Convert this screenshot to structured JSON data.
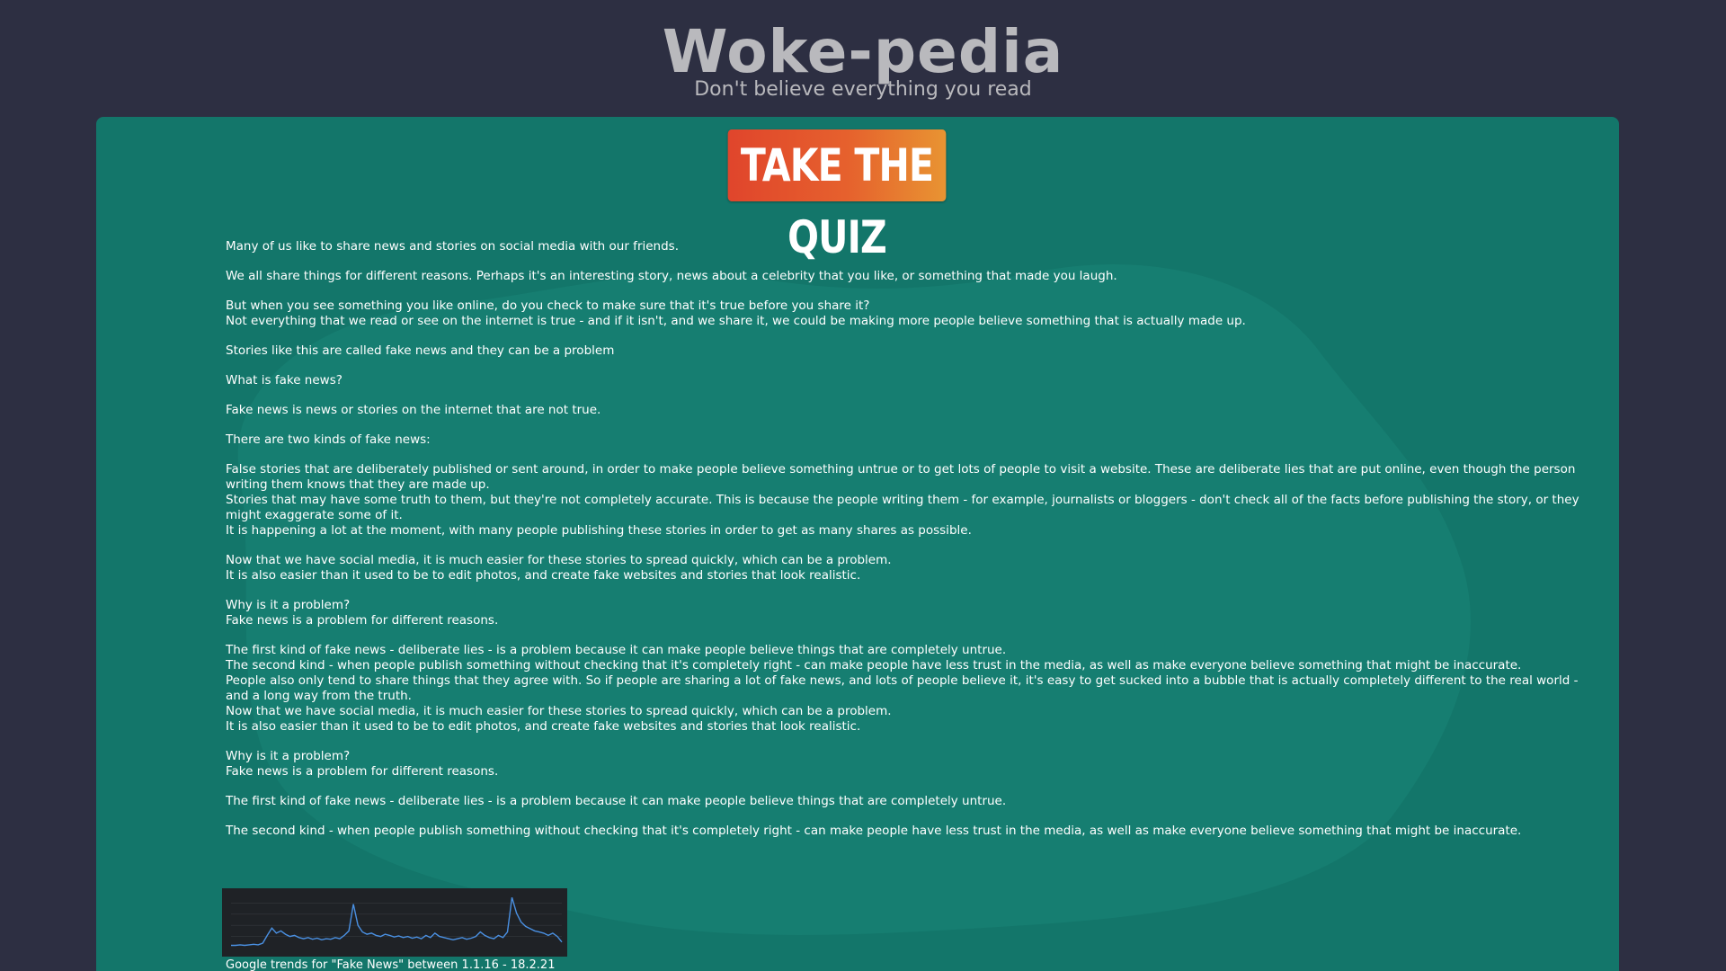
{
  "header": {
    "title": "Woke-pedia",
    "subtitle": "Don't believe everything you read"
  },
  "quiz_button": {
    "label": "TAKE THE QUIZ",
    "gradient_start": "#e0452c",
    "gradient_end": "#e89432"
  },
  "colors": {
    "page_background": "#2d2f42",
    "panel_background": "#13766a",
    "title_text": "#b9b9bd",
    "body_text": "#ffffff",
    "chart_line": "#4a90e2"
  },
  "article": {
    "paragraphs": [
      [
        "Many of us like to share news and stories on social media with our friends."
      ],
      [
        "We all share things for different reasons. Perhaps it's an interesting story, news about a celebrity that you like, or something that made you laugh."
      ],
      [
        "But when you see something you like online, do you check to make sure that it's true before you share it?",
        "Not everything that we read or see on the internet is true - and if it isn't, and we share it, we could be making more people believe something that is actually made up."
      ],
      [
        "Stories like this are called fake news and they can be a problem"
      ],
      [
        "What is fake news?"
      ],
      [
        "Fake news is news or stories on the internet that are not true."
      ],
      [
        "There are two kinds of fake news:"
      ],
      [
        "False stories that are deliberately published or sent around, in order to make people believe something untrue or to get lots of people to visit a website. These are deliberate lies that are put online, even though the person writing them knows that they are made up.",
        "Stories that may have some truth to them, but they're not completely accurate. This is because the people writing them - for example, journalists or bloggers - don't check all of the facts before publishing the story, or they might exaggerate some of it.",
        "It is happening a lot at the moment, with many people publishing these stories in order to get as many shares as possible."
      ],
      [
        "Now that we have social media, it is much easier for these stories to spread quickly, which can be a problem.",
        "It is also easier than it used to be to edit photos, and create fake websites and stories that look realistic."
      ],
      [
        "Why is it a problem?",
        "Fake news is a problem for different reasons."
      ],
      [
        "The first kind of fake news - deliberate lies - is a problem because it can make people believe things that are completely untrue.",
        "The second kind - when people publish something without checking that it's completely right - can make people have less trust in the media, as well as make everyone believe something that might be inaccurate.",
        "People also only tend to share things that they agree with. So if people are sharing a lot of fake news, and lots of people believe it, it's easy to get sucked into a bubble that is actually completely different to the real world - and a long way from the truth.",
        "Now that we have social media, it is much easier for these stories to spread quickly, which can be a problem.",
        "It is also easier than it used to be to edit photos, and create fake websites and stories that look realistic."
      ],
      [
        "Why is it a problem?",
        "Fake news is a problem for different reasons."
      ],
      [
        "The first kind of fake news - deliberate lies - is a problem because it can make people believe things that are completely untrue."
      ],
      [
        "The second kind - when people publish something without checking that it's completely right - can make people have less trust in the media, as well as make everyone believe something that might be inaccurate."
      ]
    ]
  },
  "trend_figure": {
    "caption": "Google trends for \"Fake News\" between 1.1.16 - 18.2.21",
    "series": [
      4,
      4,
      5,
      4,
      5,
      6,
      5,
      8,
      22,
      35,
      26,
      30,
      24,
      20,
      22,
      18,
      16,
      18,
      15,
      17,
      14,
      16,
      15,
      18,
      16,
      22,
      30,
      78,
      40,
      28,
      24,
      26,
      22,
      20,
      24,
      22,
      19,
      21,
      18,
      20,
      17,
      19,
      16,
      22,
      18,
      26,
      20,
      18,
      16,
      14,
      16,
      18,
      15,
      17,
      20,
      28,
      22,
      18,
      16,
      22,
      18,
      28,
      90,
      62,
      46,
      38,
      34,
      30,
      28,
      26,
      22,
      26,
      20,
      10
    ]
  }
}
